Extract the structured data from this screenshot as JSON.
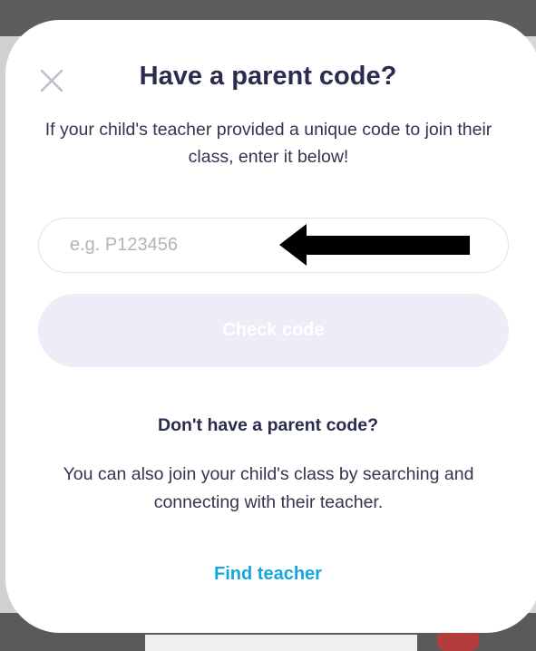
{
  "dialog": {
    "title": "Have a parent code?",
    "subtitle": "If your child's teacher provided a unique code to join their class, enter it below!",
    "close_icon": "close-icon"
  },
  "code_input": {
    "placeholder": "e.g. P123456",
    "value": ""
  },
  "annotation": {
    "icon": "left-arrow-icon",
    "color": "#000000"
  },
  "check_button": {
    "label": "Check code",
    "state": "disabled"
  },
  "alternative": {
    "title": "Don't have a parent code?",
    "description": "You can also join your child's class by searching and connecting with their teacher.",
    "link_label": "Find teacher"
  },
  "colors": {
    "title_text": "#2a2c4f",
    "body_text": "#33354f",
    "link": "#16a6de",
    "disabled_button_bg": "#ecedf7"
  }
}
